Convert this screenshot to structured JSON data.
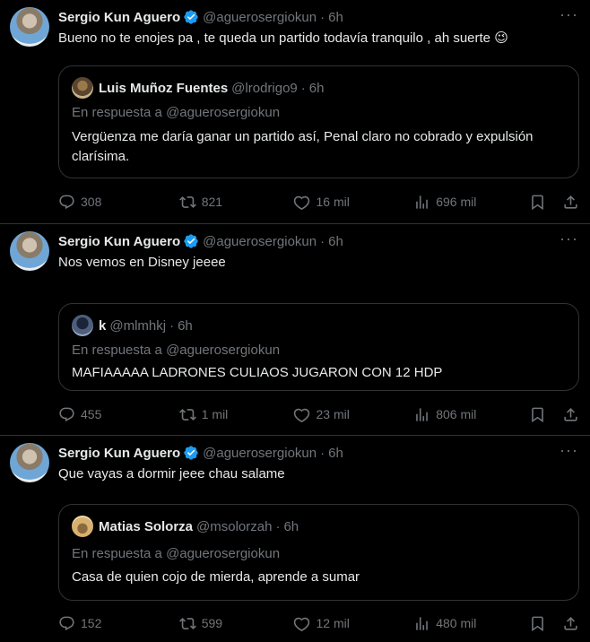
{
  "tweets": [
    {
      "author": "Sergio Kun Aguero",
      "handle": "@aguerosergiokun",
      "time": "6h",
      "text": "Bueno no te enojes pa , te queda un partido todavía tranquilo , ah suerte 😉",
      "quote": {
        "author": "Luis Muñoz Fuentes",
        "handle": "@lrodrigo9",
        "time": "6h",
        "reply_to": "En respuesta a @aguerosergiokun",
        "text": "Vergüenza me daría ganar un partido así, Penal claro no cobrado y expulsión clarísima."
      },
      "stats": {
        "replies": "308",
        "retweets": "821",
        "likes": "16 mil",
        "views": "696 mil"
      }
    },
    {
      "author": "Sergio Kun Aguero",
      "handle": "@aguerosergiokun",
      "time": "6h",
      "text": "Nos vemos en Disney jeeee",
      "quote": {
        "author": "k",
        "handle": "@mlmhkj",
        "time": "6h",
        "reply_to": "En respuesta a @aguerosergiokun",
        "text": "MAFIAAAAA LADRONES CULIAOS JUGARON CON 12 HDP"
      },
      "stats": {
        "replies": "455",
        "retweets": "1 mil",
        "likes": "23 mil",
        "views": "806 mil"
      }
    },
    {
      "author": "Sergio Kun Aguero",
      "handle": "@aguerosergiokun",
      "time": "6h",
      "text": "Que vayas a dormir jeee chau salame",
      "quote": {
        "author": "Matias Solorza",
        "handle": "@msolorzah",
        "time": "6h",
        "reply_to": "En respuesta a @aguerosergiokun",
        "text": "Casa de quien cojo de mierda, aprende a sumar"
      },
      "stats": {
        "replies": "152",
        "retweets": "599",
        "likes": "12 mil",
        "views": "480 mil"
      }
    }
  ],
  "ui": {
    "dot": "·",
    "more": "···"
  },
  "colors": {
    "background": "#000000",
    "text": "#e7e9ea",
    "muted": "#71767b",
    "border": "#2f3336",
    "verified": "#1d9bf0"
  },
  "icons": [
    "reply-icon",
    "retweet-icon",
    "like-icon",
    "views-icon",
    "bookmark-icon",
    "share-icon",
    "verified-badge-icon",
    "more-icon"
  ]
}
